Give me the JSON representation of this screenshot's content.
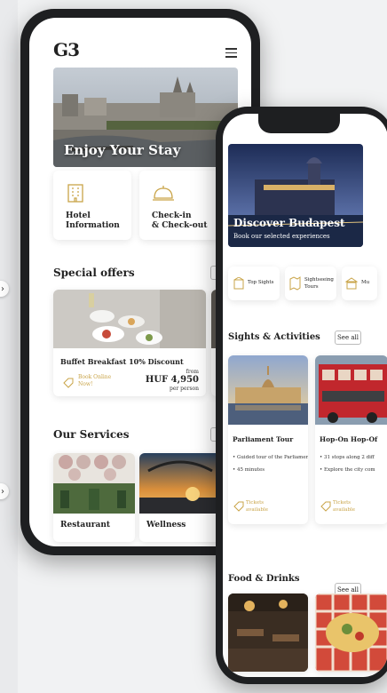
{
  "left_phone": {
    "logo": "G3",
    "hero_title": "Enjoy Your Stay",
    "tiles": [
      {
        "label_line1": "Hotel",
        "label_line2": "Information",
        "icon": "building-icon"
      },
      {
        "label_line1": "Check-in",
        "label_line2": "& Check-out",
        "icon": "reception-bell-icon"
      }
    ],
    "special_offers": {
      "title": "Special offers",
      "see_all": "Se",
      "offer": {
        "title": "Buffet Breakfast 10% Discount",
        "book_line1": "Book Online",
        "book_line2": "Now!",
        "from": "from",
        "price": "HUF 4,950",
        "per": "per person"
      }
    },
    "services": {
      "title": "Our Services",
      "see_all": "Se",
      "items": [
        {
          "label": "Restaurant"
        },
        {
          "label": "Wellness"
        }
      ]
    }
  },
  "right_phone": {
    "hero_title": "Discover Budapest",
    "hero_subtitle": "Book our selected experiences",
    "categories": [
      {
        "label": "Top Sights",
        "icon": "landmark-icon"
      },
      {
        "label_line1": "Sightseeing",
        "label_line2": "Tours",
        "icon": "map-icon"
      },
      {
        "label": "Mu",
        "icon": "museum-icon"
      }
    ],
    "sights": {
      "title": "Sights & Activities",
      "see_all": "See all",
      "items": [
        {
          "title": "Parliament Tour",
          "bullets": [
            "• Guided tour of the Parliament",
            "• 45 minutes"
          ],
          "cta_line1": "Tickets",
          "cta_line2": "available"
        },
        {
          "title": "Hop-On Hop-Of",
          "bullets": [
            "• 31 stops along 2 diff",
            "• Explore the city com"
          ],
          "cta_line1": "Tickets",
          "cta_line2": "available"
        }
      ]
    },
    "food": {
      "title": "Food & Drinks",
      "see_all": "See all"
    }
  },
  "colors": {
    "accent_gold": "#c9a448",
    "phone_frame": "#1e1f21",
    "background": "#f1f2f3"
  }
}
